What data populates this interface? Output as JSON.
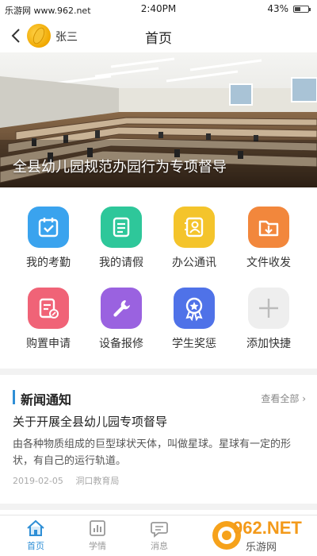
{
  "status_bar": {
    "site_label": "乐游网 www.962.net",
    "time": "2:40PM",
    "battery_percent": "43%",
    "battery_level": 0.43
  },
  "nav": {
    "user_name": "张三",
    "title": "首页"
  },
  "banner": {
    "caption": "全县幼儿园规范办园行为专项督导"
  },
  "grid_items": [
    {
      "label": "我的考勤",
      "icon": "calendar-check-icon",
      "color": "#3aa3ee"
    },
    {
      "label": "我的请假",
      "icon": "document-list-icon",
      "color": "#2ec79a"
    },
    {
      "label": "办公通讯",
      "icon": "contact-book-icon",
      "color": "#f4c42b"
    },
    {
      "label": "文件收发",
      "icon": "folder-download-icon",
      "color": "#f2873c"
    },
    {
      "label": "购置申请",
      "icon": "purchase-form-icon",
      "color": "#f06377"
    },
    {
      "label": "设备报修",
      "icon": "wrench-icon",
      "color": "#9a62e0"
    },
    {
      "label": "学生奖惩",
      "icon": "award-medal-icon",
      "color": "#4f72e8"
    },
    {
      "label": "添加快捷",
      "icon": "plus-icon",
      "color": "#eeeeee"
    }
  ],
  "news": {
    "section_title": "新闻通知",
    "view_all": "查看全部",
    "article": {
      "title": "关于开展全县幼儿园专项督导",
      "summary": "由各种物质组成的巨型球状天体，叫做星球。星球有一定的形状，有自己的运行轨道。",
      "date": "2019-02-05",
      "source": "洞口教育局"
    }
  },
  "tabs": [
    {
      "label": "首页",
      "icon": "home-icon",
      "active": true
    },
    {
      "label": "学情",
      "icon": "bar-chart-icon",
      "active": false
    },
    {
      "label": "消息",
      "icon": "chat-bubble-icon",
      "active": false
    }
  ],
  "watermark": {
    "brand": "962.NET",
    "name": "乐游网"
  },
  "colors": {
    "accent": "#2f8fd6",
    "inactive_tab": "#999999"
  }
}
